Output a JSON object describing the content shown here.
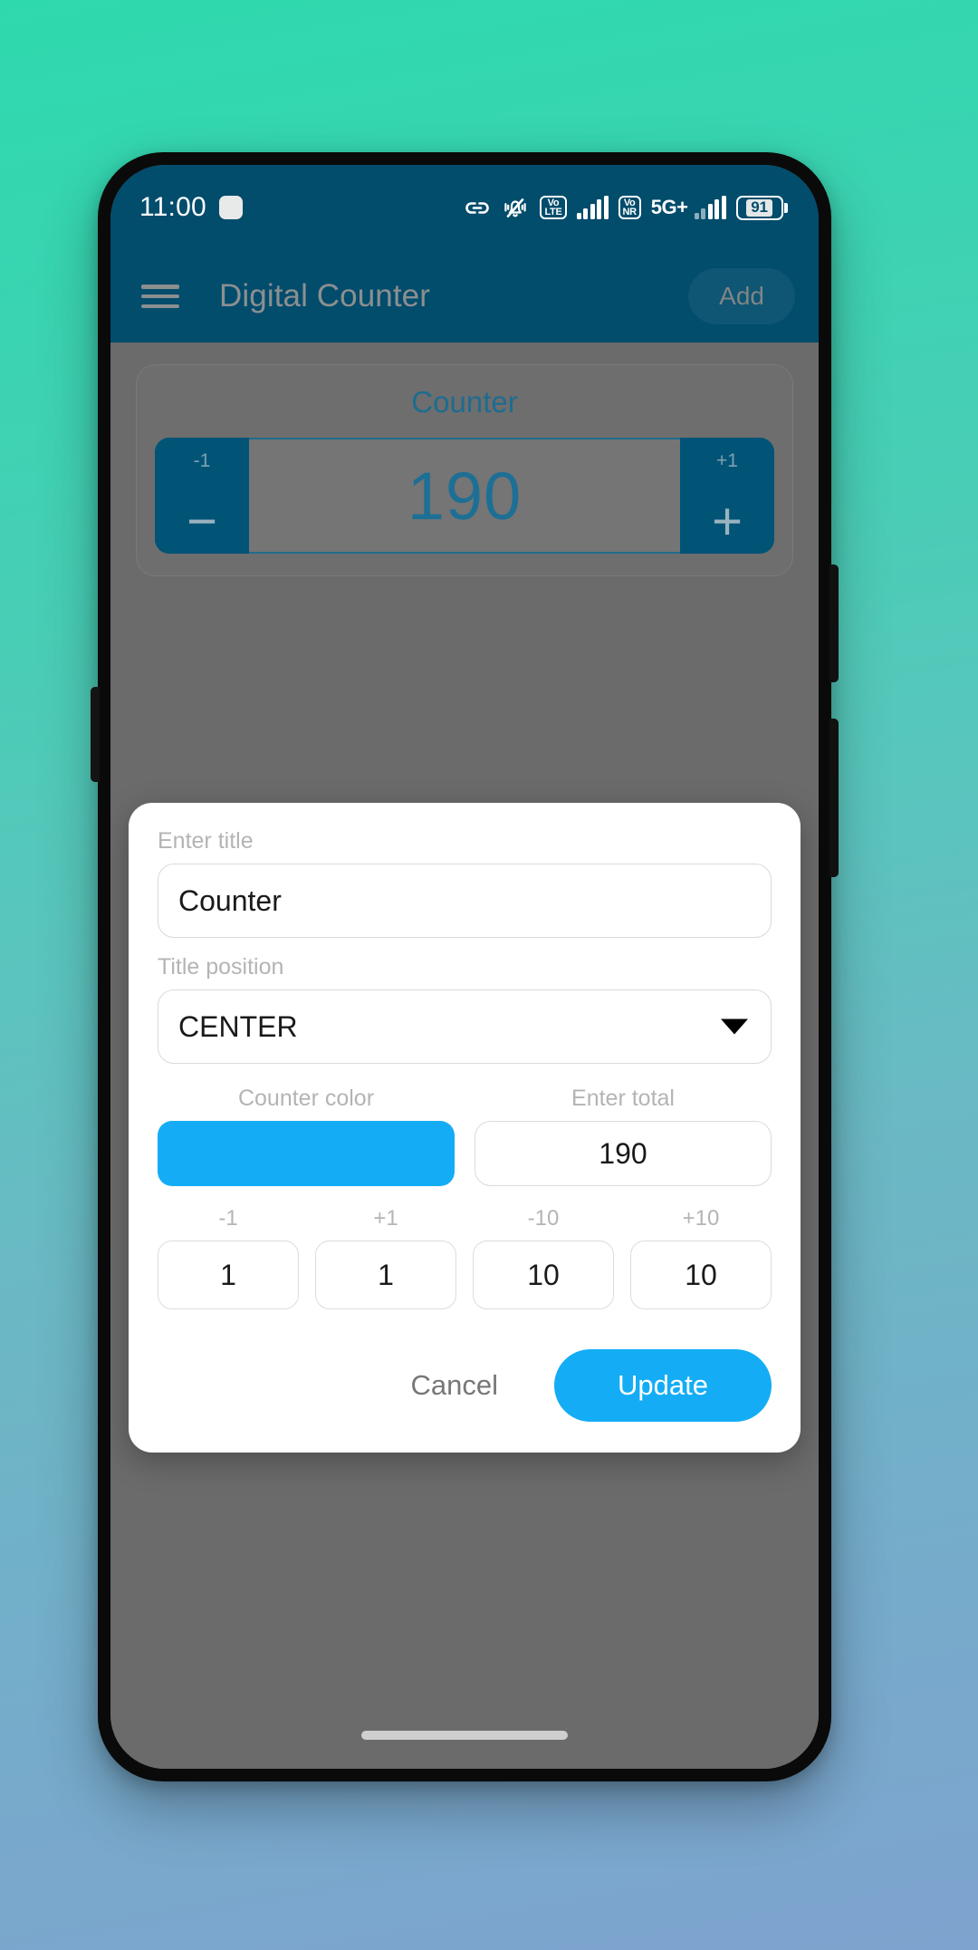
{
  "status_bar": {
    "clock": "11:00",
    "icons": {
      "link": "link-icon",
      "silent": "bell-muted-icon",
      "volte": {
        "line1": "Vo",
        "line2": "LTE"
      },
      "vonr": {
        "line1": "Vo",
        "line2": "NR"
      },
      "network": "5G+"
    },
    "battery_level": "91"
  },
  "app_bar": {
    "menu_icon": "hamburger-menu-icon",
    "title": "Digital Counter",
    "add_label": "Add"
  },
  "counter_card": {
    "title": "Counter",
    "decrement_label": "-1",
    "decrement_glyph": "−",
    "value": "190",
    "increment_label": "+1",
    "increment_glyph": "+"
  },
  "dialog": {
    "title_field": {
      "label": "Enter title",
      "value": "Counter",
      "placeholder": "Enter title"
    },
    "position_field": {
      "label": "Title position",
      "value": "CENTER",
      "caret_icon": "chevron-down-icon"
    },
    "color_field": {
      "label": "Counter color",
      "value": "#14adf5"
    },
    "total_field": {
      "label": "Enter total",
      "value": "190",
      "placeholder": "Enter total"
    },
    "steps": [
      {
        "label": "-1",
        "value": "1"
      },
      {
        "label": "+1",
        "value": "1"
      },
      {
        "label": "-10",
        "value": "10"
      },
      {
        "label": "+10",
        "value": "10"
      }
    ],
    "cancel_label": "Cancel",
    "update_label": "Update"
  },
  "theme": {
    "app_bar_color": "#024c6c",
    "accent_color": "#14adf5",
    "counter_text_color": "#1d6f95",
    "scrim_color": "#6b6b6b"
  }
}
